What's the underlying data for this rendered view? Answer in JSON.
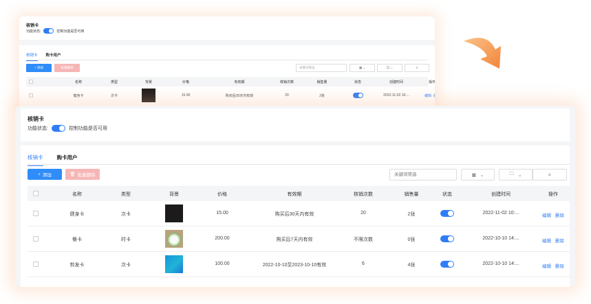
{
  "back": {
    "title": "核销卡",
    "status_label": "功能状态:",
    "status_desc": "控制功能是否可用",
    "tabs": [
      "核销卡",
      "购卡用户"
    ],
    "add_label": "+ 添加",
    "delete_label": "批量删除",
    "search_placeholder": "关键词筛选",
    "columns": [
      "名称",
      "类型",
      "背景",
      "价格",
      "有效期",
      "核销次数",
      "销售量",
      "状态",
      "创建时间",
      "操作"
    ],
    "row": {
      "name": "健身卡",
      "type": "次卡",
      "price": "15.00",
      "validity": "购买后30天内有效",
      "count": "20",
      "sales": "2张",
      "created": "2022-11-02 10:...",
      "edit": "编辑",
      "delete": "删除"
    }
  },
  "front": {
    "title": "核销卡",
    "status_label": "功能状态:",
    "status_desc": "控制功能是否可用",
    "tabs": [
      "核销卡",
      "购卡用户"
    ],
    "add_label": "添加",
    "delete_label": "批量删除",
    "search_placeholder": "关键词筛选",
    "columns": [
      "名称",
      "类型",
      "背景",
      "价格",
      "有效期",
      "核销次数",
      "销售量",
      "状态",
      "创建时间",
      "操作"
    ],
    "rows": [
      {
        "name": "健身卡",
        "type": "次卡",
        "price": "15.00",
        "validity": "购买后30天内有效",
        "count": "20",
        "sales": "2张",
        "created": "2022-11-02 10:...",
        "edit": "编辑",
        "delete": "删除",
        "enabled": true
      },
      {
        "name": "餐卡",
        "type": "时卡",
        "price": "200.00",
        "validity": "购买后7天内有效",
        "count": "不限次数",
        "sales": "0张",
        "created": "2022-10-10 14:...",
        "edit": "编辑",
        "delete": "删除",
        "enabled": true
      },
      {
        "name": "剪发卡",
        "type": "次卡",
        "price": "100.00",
        "validity": "2022-10-10至2023-10-10有效",
        "count": "6",
        "sales": "4张",
        "created": "2022-10-10 14:...",
        "edit": "编辑",
        "delete": "删除",
        "enabled": true
      }
    ]
  },
  "colors": {
    "accent": "#2f7df6",
    "danger_light": "#f6b6b6",
    "arrow": "#f79a4a"
  }
}
